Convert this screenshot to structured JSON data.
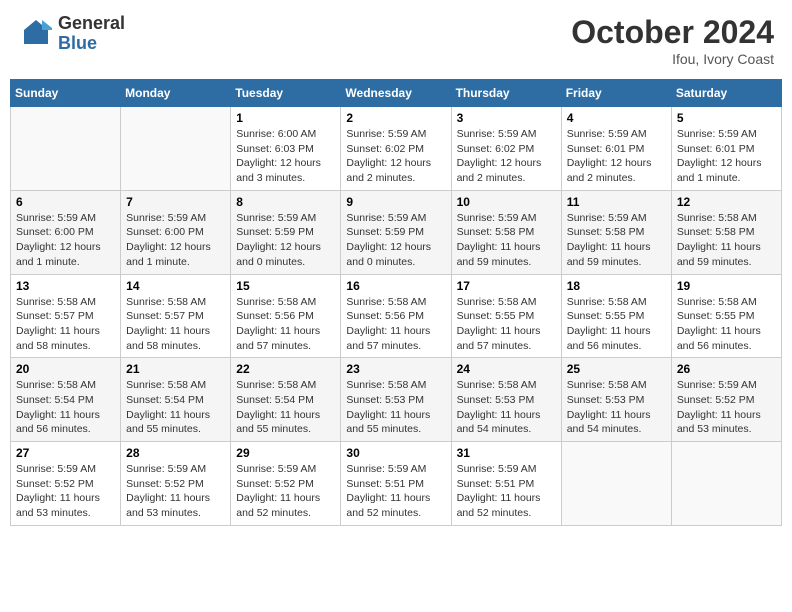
{
  "header": {
    "logo_line1": "General",
    "logo_line2": "Blue",
    "month": "October 2024",
    "location": "Ifou, Ivory Coast"
  },
  "weekdays": [
    "Sunday",
    "Monday",
    "Tuesday",
    "Wednesday",
    "Thursday",
    "Friday",
    "Saturday"
  ],
  "weeks": [
    [
      {
        "day": "",
        "info": ""
      },
      {
        "day": "",
        "info": ""
      },
      {
        "day": "1",
        "info": "Sunrise: 6:00 AM\nSunset: 6:03 PM\nDaylight: 12 hours and 3 minutes."
      },
      {
        "day": "2",
        "info": "Sunrise: 5:59 AM\nSunset: 6:02 PM\nDaylight: 12 hours and 2 minutes."
      },
      {
        "day": "3",
        "info": "Sunrise: 5:59 AM\nSunset: 6:02 PM\nDaylight: 12 hours and 2 minutes."
      },
      {
        "day": "4",
        "info": "Sunrise: 5:59 AM\nSunset: 6:01 PM\nDaylight: 12 hours and 2 minutes."
      },
      {
        "day": "5",
        "info": "Sunrise: 5:59 AM\nSunset: 6:01 PM\nDaylight: 12 hours and 1 minute."
      }
    ],
    [
      {
        "day": "6",
        "info": "Sunrise: 5:59 AM\nSunset: 6:00 PM\nDaylight: 12 hours and 1 minute."
      },
      {
        "day": "7",
        "info": "Sunrise: 5:59 AM\nSunset: 6:00 PM\nDaylight: 12 hours and 1 minute."
      },
      {
        "day": "8",
        "info": "Sunrise: 5:59 AM\nSunset: 5:59 PM\nDaylight: 12 hours and 0 minutes."
      },
      {
        "day": "9",
        "info": "Sunrise: 5:59 AM\nSunset: 5:59 PM\nDaylight: 12 hours and 0 minutes."
      },
      {
        "day": "10",
        "info": "Sunrise: 5:59 AM\nSunset: 5:58 PM\nDaylight: 11 hours and 59 minutes."
      },
      {
        "day": "11",
        "info": "Sunrise: 5:59 AM\nSunset: 5:58 PM\nDaylight: 11 hours and 59 minutes."
      },
      {
        "day": "12",
        "info": "Sunrise: 5:58 AM\nSunset: 5:58 PM\nDaylight: 11 hours and 59 minutes."
      }
    ],
    [
      {
        "day": "13",
        "info": "Sunrise: 5:58 AM\nSunset: 5:57 PM\nDaylight: 11 hours and 58 minutes."
      },
      {
        "day": "14",
        "info": "Sunrise: 5:58 AM\nSunset: 5:57 PM\nDaylight: 11 hours and 58 minutes."
      },
      {
        "day": "15",
        "info": "Sunrise: 5:58 AM\nSunset: 5:56 PM\nDaylight: 11 hours and 57 minutes."
      },
      {
        "day": "16",
        "info": "Sunrise: 5:58 AM\nSunset: 5:56 PM\nDaylight: 11 hours and 57 minutes."
      },
      {
        "day": "17",
        "info": "Sunrise: 5:58 AM\nSunset: 5:55 PM\nDaylight: 11 hours and 57 minutes."
      },
      {
        "day": "18",
        "info": "Sunrise: 5:58 AM\nSunset: 5:55 PM\nDaylight: 11 hours and 56 minutes."
      },
      {
        "day": "19",
        "info": "Sunrise: 5:58 AM\nSunset: 5:55 PM\nDaylight: 11 hours and 56 minutes."
      }
    ],
    [
      {
        "day": "20",
        "info": "Sunrise: 5:58 AM\nSunset: 5:54 PM\nDaylight: 11 hours and 56 minutes."
      },
      {
        "day": "21",
        "info": "Sunrise: 5:58 AM\nSunset: 5:54 PM\nDaylight: 11 hours and 55 minutes."
      },
      {
        "day": "22",
        "info": "Sunrise: 5:58 AM\nSunset: 5:54 PM\nDaylight: 11 hours and 55 minutes."
      },
      {
        "day": "23",
        "info": "Sunrise: 5:58 AM\nSunset: 5:53 PM\nDaylight: 11 hours and 55 minutes."
      },
      {
        "day": "24",
        "info": "Sunrise: 5:58 AM\nSunset: 5:53 PM\nDaylight: 11 hours and 54 minutes."
      },
      {
        "day": "25",
        "info": "Sunrise: 5:58 AM\nSunset: 5:53 PM\nDaylight: 11 hours and 54 minutes."
      },
      {
        "day": "26",
        "info": "Sunrise: 5:59 AM\nSunset: 5:52 PM\nDaylight: 11 hours and 53 minutes."
      }
    ],
    [
      {
        "day": "27",
        "info": "Sunrise: 5:59 AM\nSunset: 5:52 PM\nDaylight: 11 hours and 53 minutes."
      },
      {
        "day": "28",
        "info": "Sunrise: 5:59 AM\nSunset: 5:52 PM\nDaylight: 11 hours and 53 minutes."
      },
      {
        "day": "29",
        "info": "Sunrise: 5:59 AM\nSunset: 5:52 PM\nDaylight: 11 hours and 52 minutes."
      },
      {
        "day": "30",
        "info": "Sunrise: 5:59 AM\nSunset: 5:51 PM\nDaylight: 11 hours and 52 minutes."
      },
      {
        "day": "31",
        "info": "Sunrise: 5:59 AM\nSunset: 5:51 PM\nDaylight: 11 hours and 52 minutes."
      },
      {
        "day": "",
        "info": ""
      },
      {
        "day": "",
        "info": ""
      }
    ]
  ]
}
